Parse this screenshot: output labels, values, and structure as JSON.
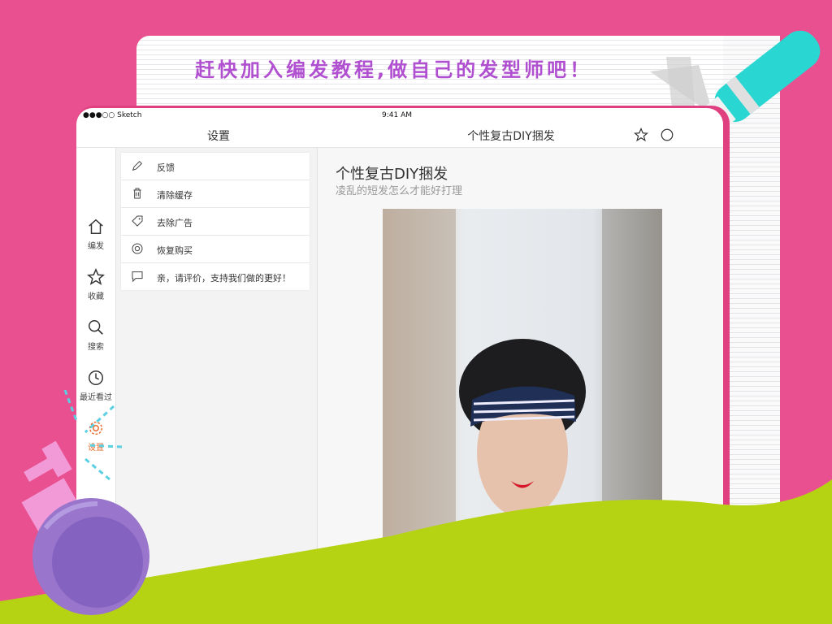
{
  "banner": {
    "tagline": "赶快加入编发教程,做自己的发型师吧！"
  },
  "status_bar": {
    "carrier": "●●●○○ Sketch",
    "time": "9:41 AM"
  },
  "navbar": {
    "left_title": "设置",
    "right_title": "个性复古DIY捆发",
    "star_icon": "star-icon",
    "more_icon": "more-icon"
  },
  "sidebar": {
    "items": [
      {
        "label": "编发",
        "icon": "home-icon"
      },
      {
        "label": "收藏",
        "icon": "star-icon"
      },
      {
        "label": "搜索",
        "icon": "search-icon"
      },
      {
        "label": "最近看过",
        "icon": "clock-icon"
      },
      {
        "label": "设置",
        "icon": "gear-icon",
        "active": true
      }
    ]
  },
  "settings_menu": {
    "items": [
      {
        "label": "反馈",
        "icon": "pencil-icon"
      },
      {
        "label": "清除缓存",
        "icon": "trash-icon"
      },
      {
        "label": "去除广告",
        "icon": "tag-icon"
      },
      {
        "label": "恢复购买",
        "icon": "lifebuoy-icon"
      },
      {
        "label": "亲，请评价，支持我们做的更好！",
        "icon": "comment-icon"
      }
    ]
  },
  "detail": {
    "title": "个性复古DIY捆发",
    "subtitle": "凌乱的短发怎么才能好打理"
  },
  "colors": {
    "background": "#e8508f",
    "accent": "#e76a2c",
    "tagline": "#b04fd0",
    "wave": "#b6d313"
  }
}
